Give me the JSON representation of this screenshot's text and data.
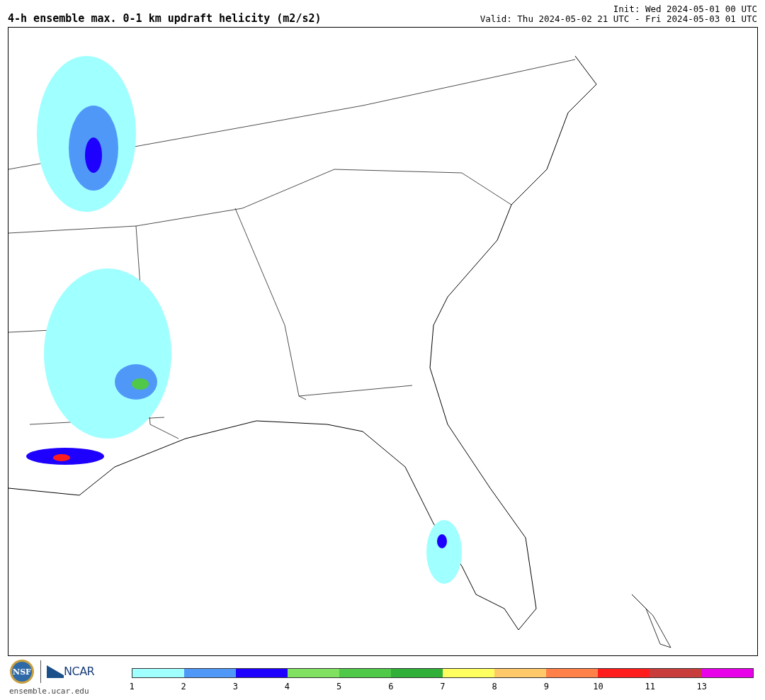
{
  "title": "4-h ensemble max. 0-1 km updraft helicity (m2/s2)",
  "init": "Init: Wed 2024-05-01 00 UTC",
  "valid": "Valid: Thu 2024-05-02 21 UTC - Fri 2024-05-03 01 UTC",
  "logos": {
    "nsf": "NSF",
    "ncar": "NCAR",
    "url": "ensemble.ucar.edu"
  },
  "colorbar": [
    {
      "label": "1",
      "color": "#a0ffff"
    },
    {
      "label": "2",
      "color": "#5098f8"
    },
    {
      "label": "3",
      "color": "#1e00ff"
    },
    {
      "label": "4",
      "color": "#80e060"
    },
    {
      "label": "5",
      "color": "#50c848"
    },
    {
      "label": "6",
      "color": "#30b038"
    },
    {
      "label": "7",
      "color": "#ffff60"
    },
    {
      "label": "8",
      "color": "#ffc868"
    },
    {
      "label": "9",
      "color": "#ff8048"
    },
    {
      "label": "10",
      "color": "#ff1c1c"
    },
    {
      "label": "11",
      "color": "#c83c3c"
    },
    {
      "label": "13",
      "color": "#e800e8"
    }
  ]
}
